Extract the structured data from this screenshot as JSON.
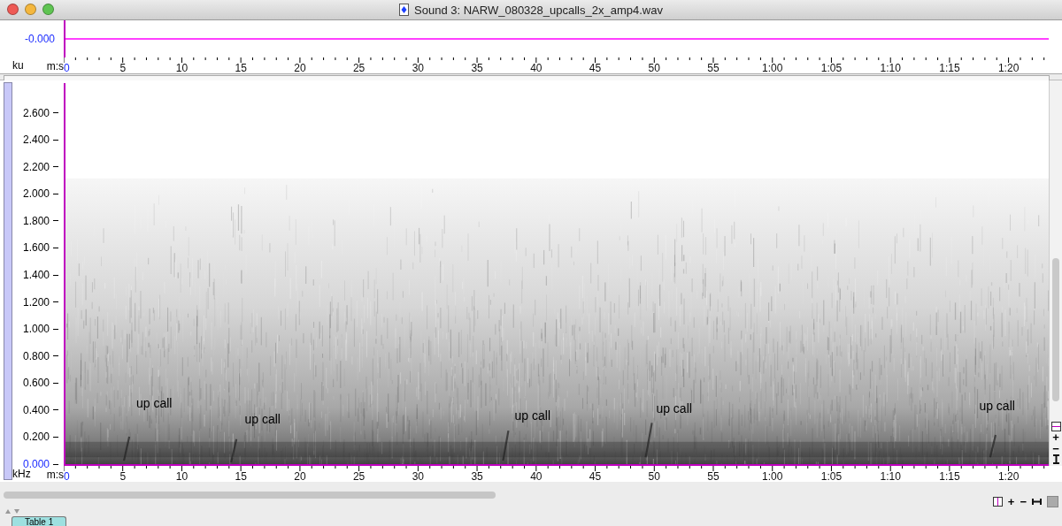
{
  "window": {
    "title": "Sound 3: NARW_080328_upcalls_2x_amp4.wav"
  },
  "waveform": {
    "y_label": "-0.000",
    "unit": "ku",
    "time_label": "m:s",
    "x_ticks": [
      "0",
      "5",
      "10",
      "15",
      "20",
      "25",
      "30",
      "35",
      "40",
      "45",
      "50",
      "55",
      "1:00",
      "1:05",
      "1:10",
      "1:15",
      "1:20"
    ]
  },
  "spectrogram": {
    "unit": "kHz",
    "time_label": "m:s",
    "y_ticks": [
      "2.600",
      "2.400",
      "2.200",
      "2.000",
      "1.800",
      "1.600",
      "1.400",
      "1.200",
      "1.000",
      "0.800",
      "0.600",
      "0.400",
      "0.200",
      "0.000"
    ],
    "x_ticks": [
      "0",
      "5",
      "10",
      "15",
      "20",
      "25",
      "30",
      "35",
      "40",
      "45",
      "50",
      "55",
      "1:00",
      "1:05",
      "1:10",
      "1:15",
      "1:20"
    ],
    "annotations": [
      "up call",
      "up call",
      "up call",
      "up call",
      "up call"
    ]
  },
  "vertical_controls": [
    "+",
    "−"
  ],
  "horizontal_controls": [
    "+",
    "−"
  ],
  "tabs": [
    {
      "label": "Table 1",
      "selected": true
    }
  ]
}
